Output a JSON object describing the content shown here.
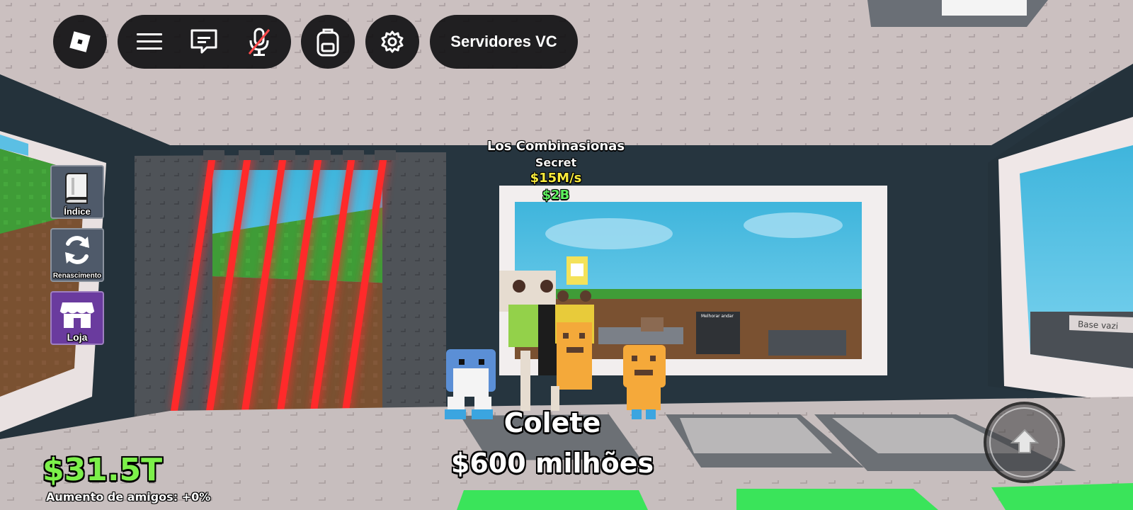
{
  "topbar": {
    "roblox_icon": "roblox-logo-icon",
    "menu_icon": "hamburger-menu-icon",
    "chat_icon": "chat-icon",
    "mic_icon": "microphone-muted-icon",
    "backpack_icon": "backpack-icon",
    "settings_icon": "gear-icon",
    "servers_label": "Servidores VC"
  },
  "side_menu": {
    "index": {
      "label": "Índice",
      "icon": "book-icon"
    },
    "rebirth": {
      "label": "Renascimento",
      "icon": "refresh-icon"
    },
    "shop": {
      "label": "Loja",
      "icon": "store-icon"
    }
  },
  "brainrot": {
    "name": "Los Combinasionas",
    "rarity": "Secret",
    "rate": "$15M/s",
    "price": "$2B"
  },
  "collect": {
    "title": "Colete",
    "amount": "$600 milhões"
  },
  "hud": {
    "money": "$31.5T",
    "friends_boost": "Aumento de amigos: +0%"
  },
  "sign": {
    "wall_text": "Base vazi",
    "small_panel": "Melhorar andar"
  },
  "jump_icon": "jump-arrow-icon",
  "colors": {
    "money_green": "#7cf04a",
    "rate_yellow": "#f7ea3c",
    "price_green": "#5ef05e",
    "laser_red": "#ff2a2a",
    "shop_purple": "#6a3b9e"
  }
}
